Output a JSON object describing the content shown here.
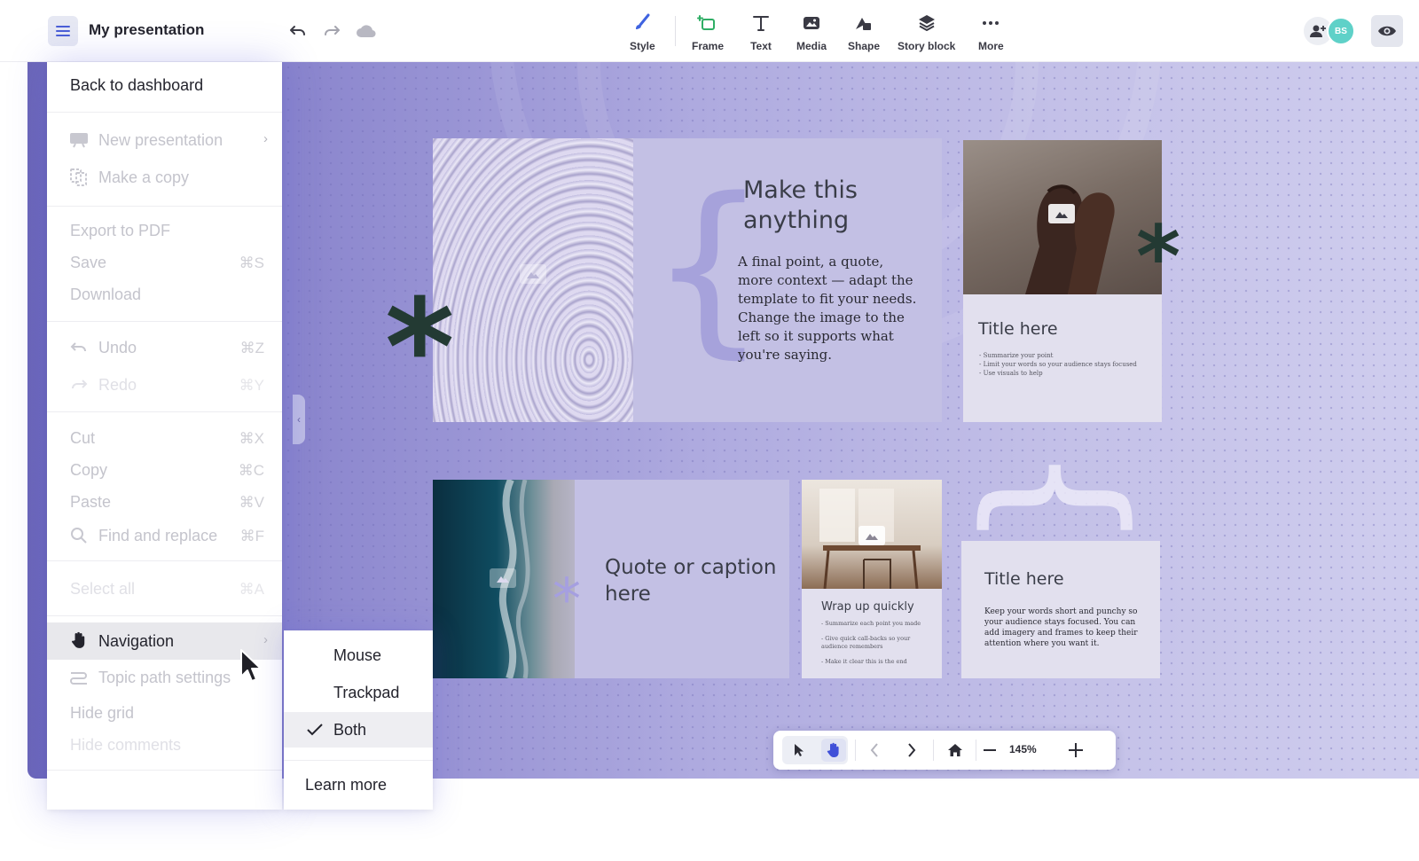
{
  "header": {
    "title": "My presentation",
    "tools": [
      {
        "label": "Style",
        "icon": "brush-icon"
      },
      {
        "label": "Frame",
        "icon": "frame-icon"
      },
      {
        "label": "Text",
        "icon": "text-icon"
      },
      {
        "label": "Media",
        "icon": "media-icon"
      },
      {
        "label": "Shape",
        "icon": "shape-icon"
      },
      {
        "label": "Story block",
        "icon": "layers-icon"
      },
      {
        "label": "More",
        "icon": "more-dots-icon"
      }
    ],
    "avatar_initials": "BS"
  },
  "menu": {
    "back": "Back to dashboard",
    "new_presentation": "New presentation",
    "make_copy": "Make a copy",
    "export_pdf": "Export to PDF",
    "save": {
      "label": "Save",
      "shortcut": "⌘S"
    },
    "download": "Download",
    "undo": {
      "label": "Undo",
      "shortcut": "⌘Z"
    },
    "redo": {
      "label": "Redo",
      "shortcut": "⌘Y"
    },
    "cut": {
      "label": "Cut",
      "shortcut": "⌘X"
    },
    "copy": {
      "label": "Copy",
      "shortcut": "⌘C"
    },
    "paste": {
      "label": "Paste",
      "shortcut": "⌘V"
    },
    "find_replace": {
      "label": "Find and replace",
      "shortcut": "⌘F"
    },
    "select_all": {
      "label": "Select all",
      "shortcut": "⌘A"
    },
    "navigation": "Navigation",
    "topic_path": "Topic path settings",
    "hide_grid": "Hide grid",
    "hide_comments": "Hide comments"
  },
  "submenu": {
    "items": [
      "Mouse",
      "Trackpad",
      "Both"
    ],
    "selected": "Both",
    "learn_more": "Learn more"
  },
  "canvas": {
    "slide1": {
      "title": "Make this anything",
      "body": "A final point, a quote, more context — adapt the template to fit your needs. Change the image to the left so it supports what you're saying."
    },
    "slide2": {
      "title": "Title here",
      "bullets": [
        "- Summarize your point",
        "- Limit your words so your audience stays focused",
        "- Use visuals to help"
      ]
    },
    "slide3": {
      "title": "Quote or caption here"
    },
    "slide4": {
      "title": "Wrap up quickly",
      "bullets": [
        "- Summarize each point you made",
        "- Give quick call-backs so your",
        "  audience remembers",
        "- Make it clear this is the end"
      ]
    },
    "slide5": {
      "title": "Title here",
      "body": "Keep your words short and punchy so your audience stays focused. You can add imagery and frames to keep their attention where you want it."
    }
  },
  "zoom": "145%",
  "colors": {
    "accent_dark": "#233a33",
    "panel_lavender": "#c3c0e4",
    "card_light": "#e2e0ee"
  }
}
